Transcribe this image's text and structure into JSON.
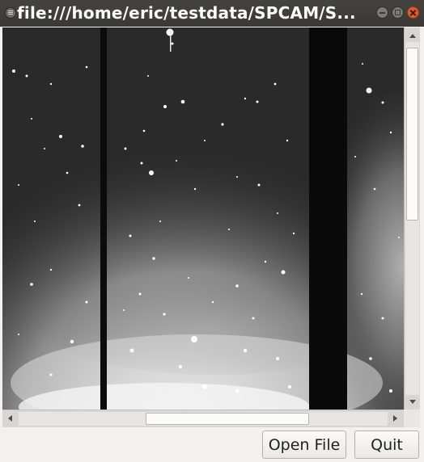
{
  "window": {
    "title": "file:///home/eric/testdata/SPCAM/S..."
  },
  "viewer": {
    "image_description_icon": "astronomical-image"
  },
  "buttons": {
    "open_file": "Open File",
    "quit": "Quit"
  },
  "colors": {
    "titlebar": "#3c3b37",
    "close_button": "#e05d2b",
    "window_bg": "#f2f1f0"
  }
}
